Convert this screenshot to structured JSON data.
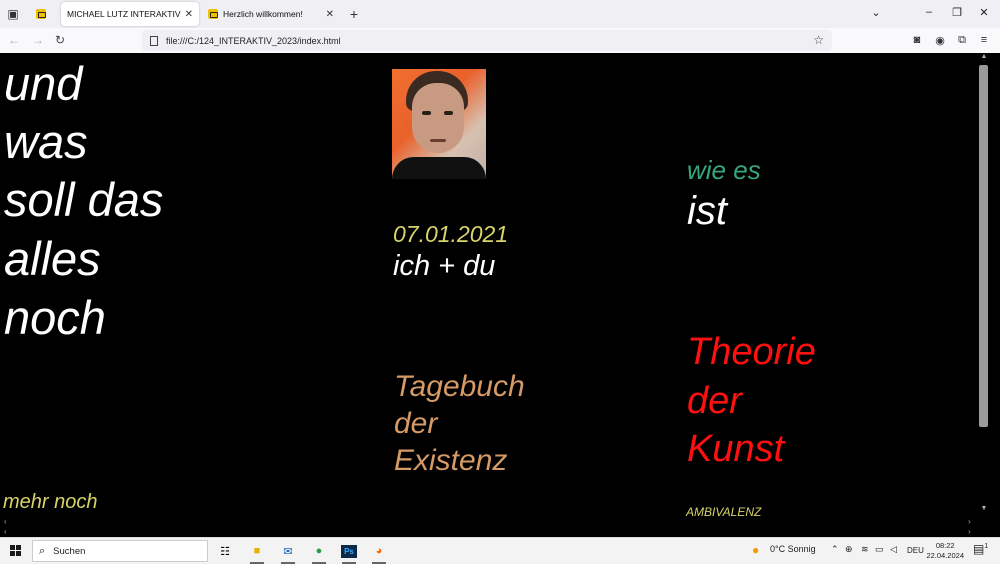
{
  "browser": {
    "tabs": [
      {
        "title": "MICHAEL LUTZ INTERAKTIVER TEXT",
        "active": true
      },
      {
        "title": "Herzlich willkommen!",
        "active": false
      }
    ],
    "url": "file:///C:/124_INTERAKTIV_2023/index.html"
  },
  "page": {
    "left_column": [
      "und",
      "was",
      "soll das",
      "alles",
      "noch"
    ],
    "left_bottom": "mehr noch",
    "date": "07.01.2021",
    "ich_du": "ich + du",
    "tagebuch": [
      "Tagebuch",
      "der",
      "Existenz"
    ],
    "wie_es": "wie es",
    "ist": "ist",
    "theorie": [
      "Theorie",
      "der",
      "Kunst"
    ],
    "ambivalenz": "AMBIVALENZ",
    "colors": {
      "white": "#ffffff",
      "yellow": "#d8d46a",
      "green": "#34a87a",
      "tan": "#d59a66",
      "red": "#ff1010"
    }
  },
  "taskbar": {
    "search_label": "Suchen",
    "weather": "0°C  Sonnig",
    "language": "DEU",
    "time": "08:22",
    "date": "22.04.2024",
    "notification_count": "1"
  }
}
